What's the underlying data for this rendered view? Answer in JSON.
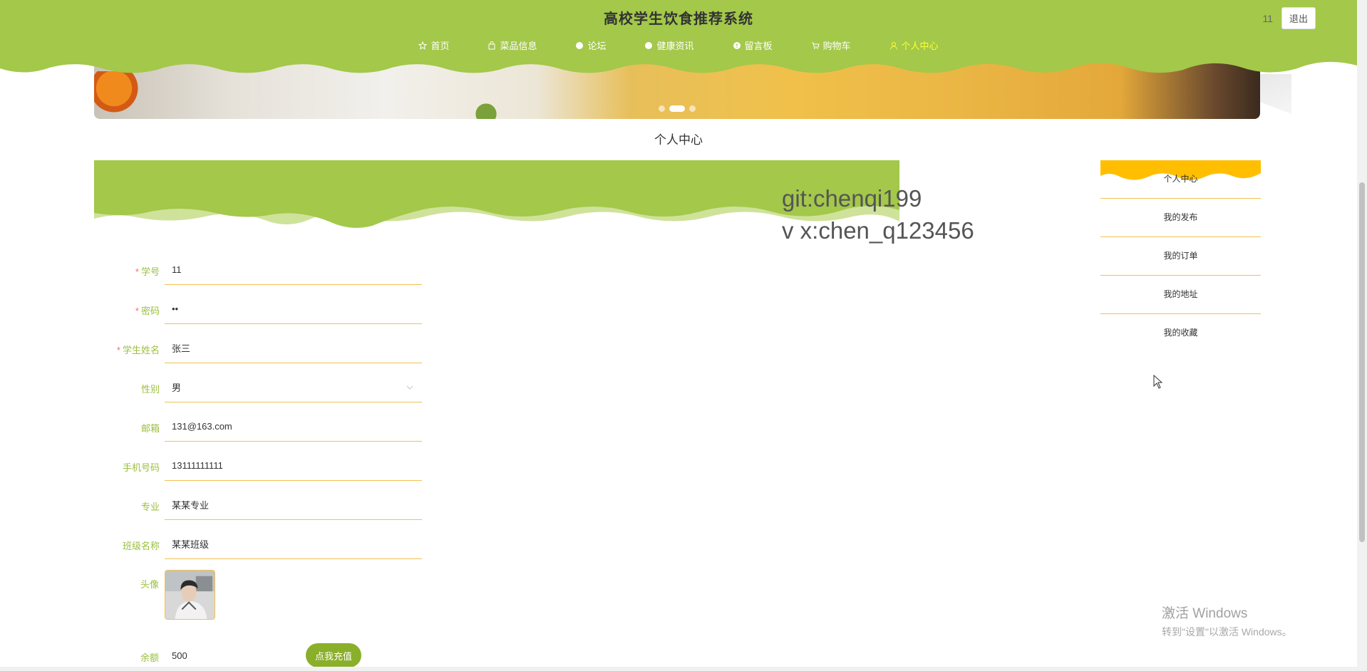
{
  "header": {
    "title": "高校学生饮食推荐系统",
    "user": "11",
    "logout_label": "退出",
    "nav": [
      {
        "label": "首页",
        "icon": "star-icon"
      },
      {
        "label": "菜品信息",
        "icon": "bag-icon"
      },
      {
        "label": "论坛",
        "icon": "circle-icon"
      },
      {
        "label": "健康资讯",
        "icon": "circle-icon"
      },
      {
        "label": "留言板",
        "icon": "info-icon"
      },
      {
        "label": "购物车",
        "icon": "cart-icon"
      },
      {
        "label": "个人中心",
        "icon": "user-icon",
        "active": true
      }
    ]
  },
  "banner": {
    "slides": 3,
    "active_slide": 2
  },
  "page_title": "个人中心",
  "watermark": {
    "line1": "git:chenqi199",
    "line2": "v x:chen_q123456"
  },
  "form": {
    "fields": [
      {
        "label": "学号",
        "required": true,
        "value": "11",
        "type": "text"
      },
      {
        "label": "密码",
        "required": true,
        "value": "11",
        "type": "password"
      },
      {
        "label": "学生姓名",
        "required": true,
        "value": "张三",
        "type": "text"
      },
      {
        "label": "性别",
        "required": false,
        "value": "男",
        "type": "select"
      },
      {
        "label": "邮箱",
        "required": false,
        "value": "131@163.com",
        "type": "text"
      },
      {
        "label": "手机号码",
        "required": false,
        "value": "13111111111",
        "type": "text"
      },
      {
        "label": "专业",
        "required": false,
        "value": "某某专业",
        "type": "text"
      },
      {
        "label": "班级名称",
        "required": false,
        "value": "某某班级",
        "type": "text"
      }
    ],
    "avatar_label": "头像",
    "balance_label": "余额",
    "balance_value": "500",
    "recharge_label": "点我充值"
  },
  "sidebar": {
    "items": [
      {
        "label": "个人中心",
        "active": true
      },
      {
        "label": "我的发布"
      },
      {
        "label": "我的订单"
      },
      {
        "label": "我的地址"
      },
      {
        "label": "我的收藏"
      }
    ]
  },
  "os_watermark": {
    "line1": "激活 Windows",
    "line2": "转到\"设置\"以激活 Windows。"
  },
  "colors": {
    "accent": "#a3c84a",
    "accent_dark": "#8aaf2a",
    "underline": "#f2c14e",
    "active_nav": "#ffff33",
    "side_active": "#ffbf00"
  }
}
